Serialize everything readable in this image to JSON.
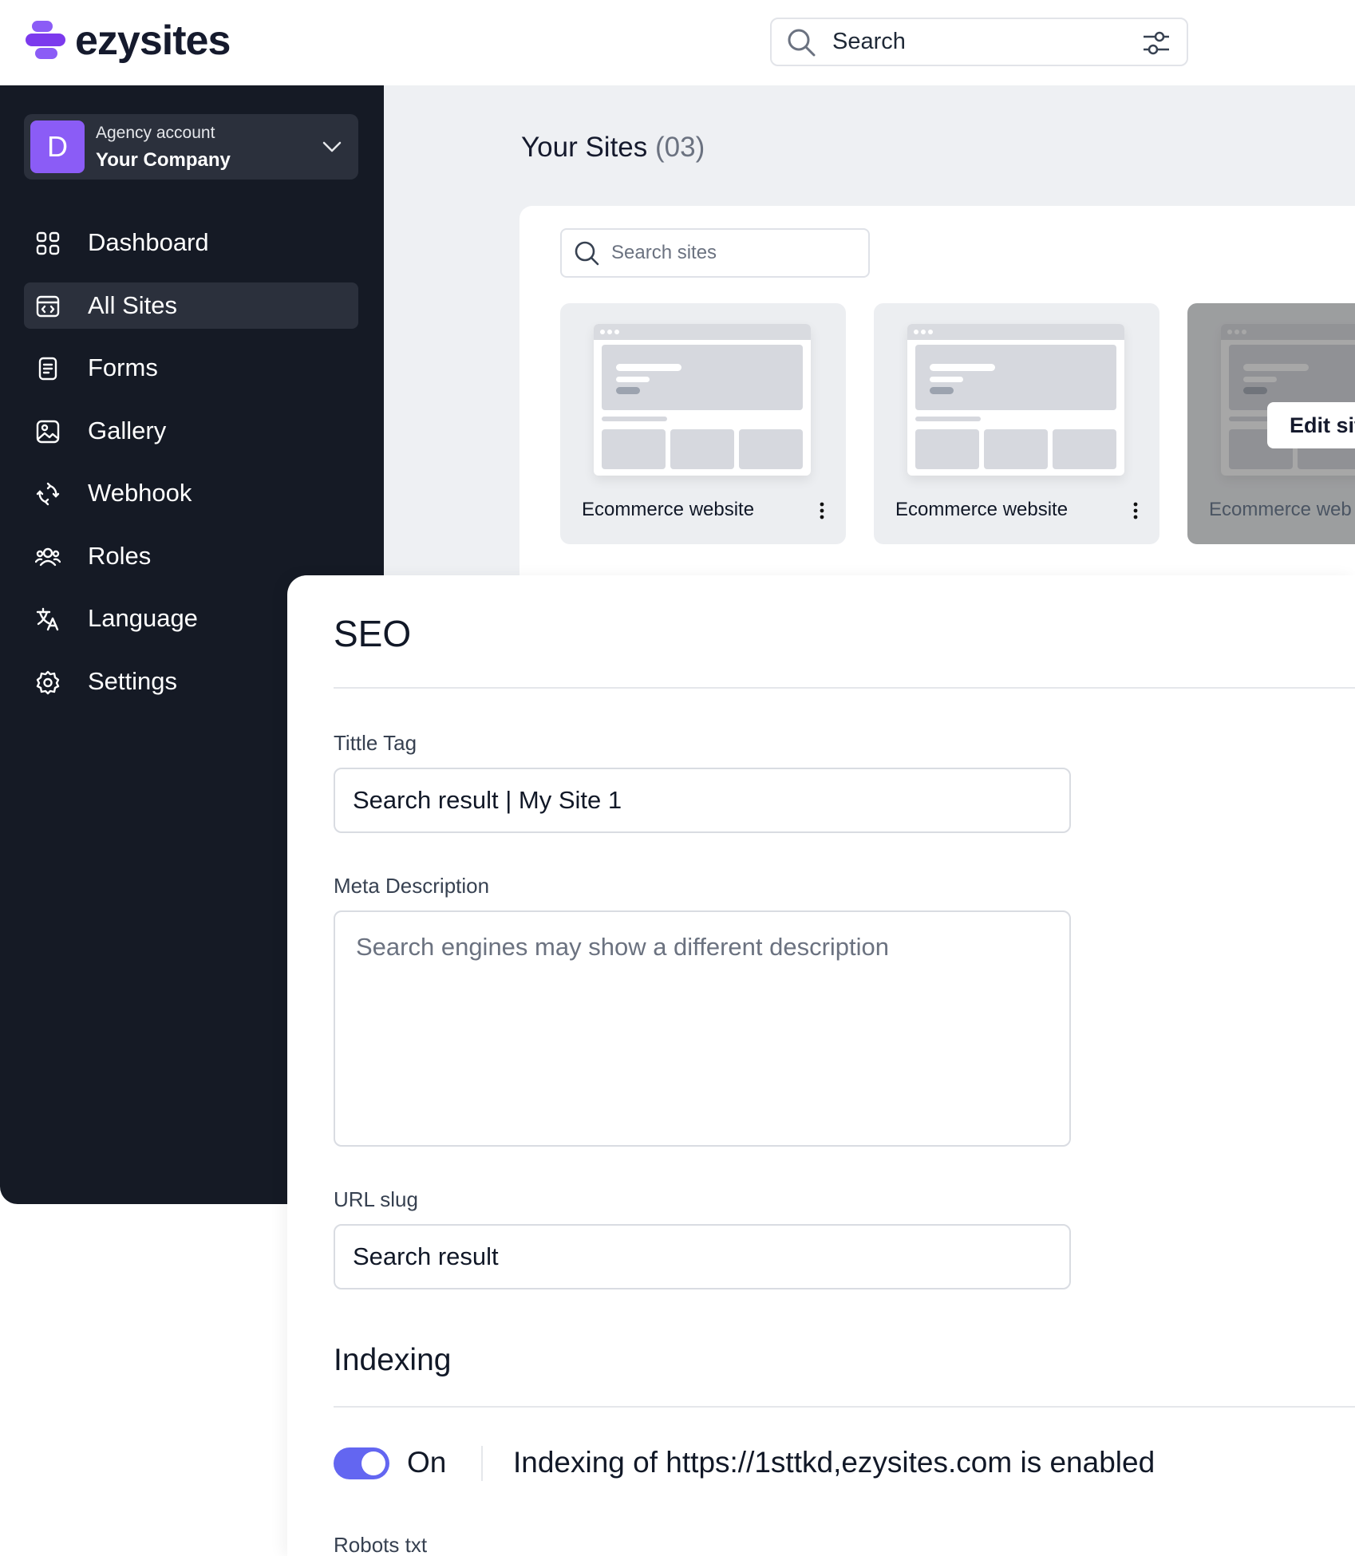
{
  "brand": {
    "name": "ezysites",
    "accent": "#8b5cf6"
  },
  "header": {
    "search_placeholder": "Search"
  },
  "sidebar": {
    "account": {
      "initial": "D",
      "type": "Agency account",
      "name": "Your Company"
    },
    "items": [
      {
        "label": "Dashboard",
        "icon": "grid-icon",
        "active": false
      },
      {
        "label": "All Sites",
        "icon": "browser-code-icon",
        "active": true
      },
      {
        "label": "Forms",
        "icon": "document-icon",
        "active": false
      },
      {
        "label": "Gallery",
        "icon": "image-icon",
        "active": false
      },
      {
        "label": "Webhook",
        "icon": "webhook-icon",
        "active": false
      },
      {
        "label": "Roles",
        "icon": "users-icon",
        "active": false
      },
      {
        "label": "Language",
        "icon": "translate-icon",
        "active": false
      },
      {
        "label": "Settings",
        "icon": "gear-icon",
        "active": false
      }
    ]
  },
  "sites": {
    "title": "Your Sites",
    "count": "(03)",
    "search_placeholder": "Search sites",
    "cards": [
      {
        "name": "Ecommerce website"
      },
      {
        "name": "Ecommerce website"
      },
      {
        "name": "Ecommerce web",
        "edit_label": "Edit sit"
      }
    ]
  },
  "seo": {
    "title": "SEO",
    "title_tag_label": "Tittle Tag",
    "title_tag_value": "Search result | My Site 1",
    "meta_label": "Meta Description",
    "meta_placeholder": "Search engines may show a different description",
    "slug_label": "URL slug",
    "slug_value": "Search result",
    "indexing_title": "Indexing",
    "toggle_label": "On",
    "toggle_on": true,
    "indexing_message": "Indexing of https://1sttkd,ezysites.com is enabled",
    "robots_label": "Robots txt"
  }
}
